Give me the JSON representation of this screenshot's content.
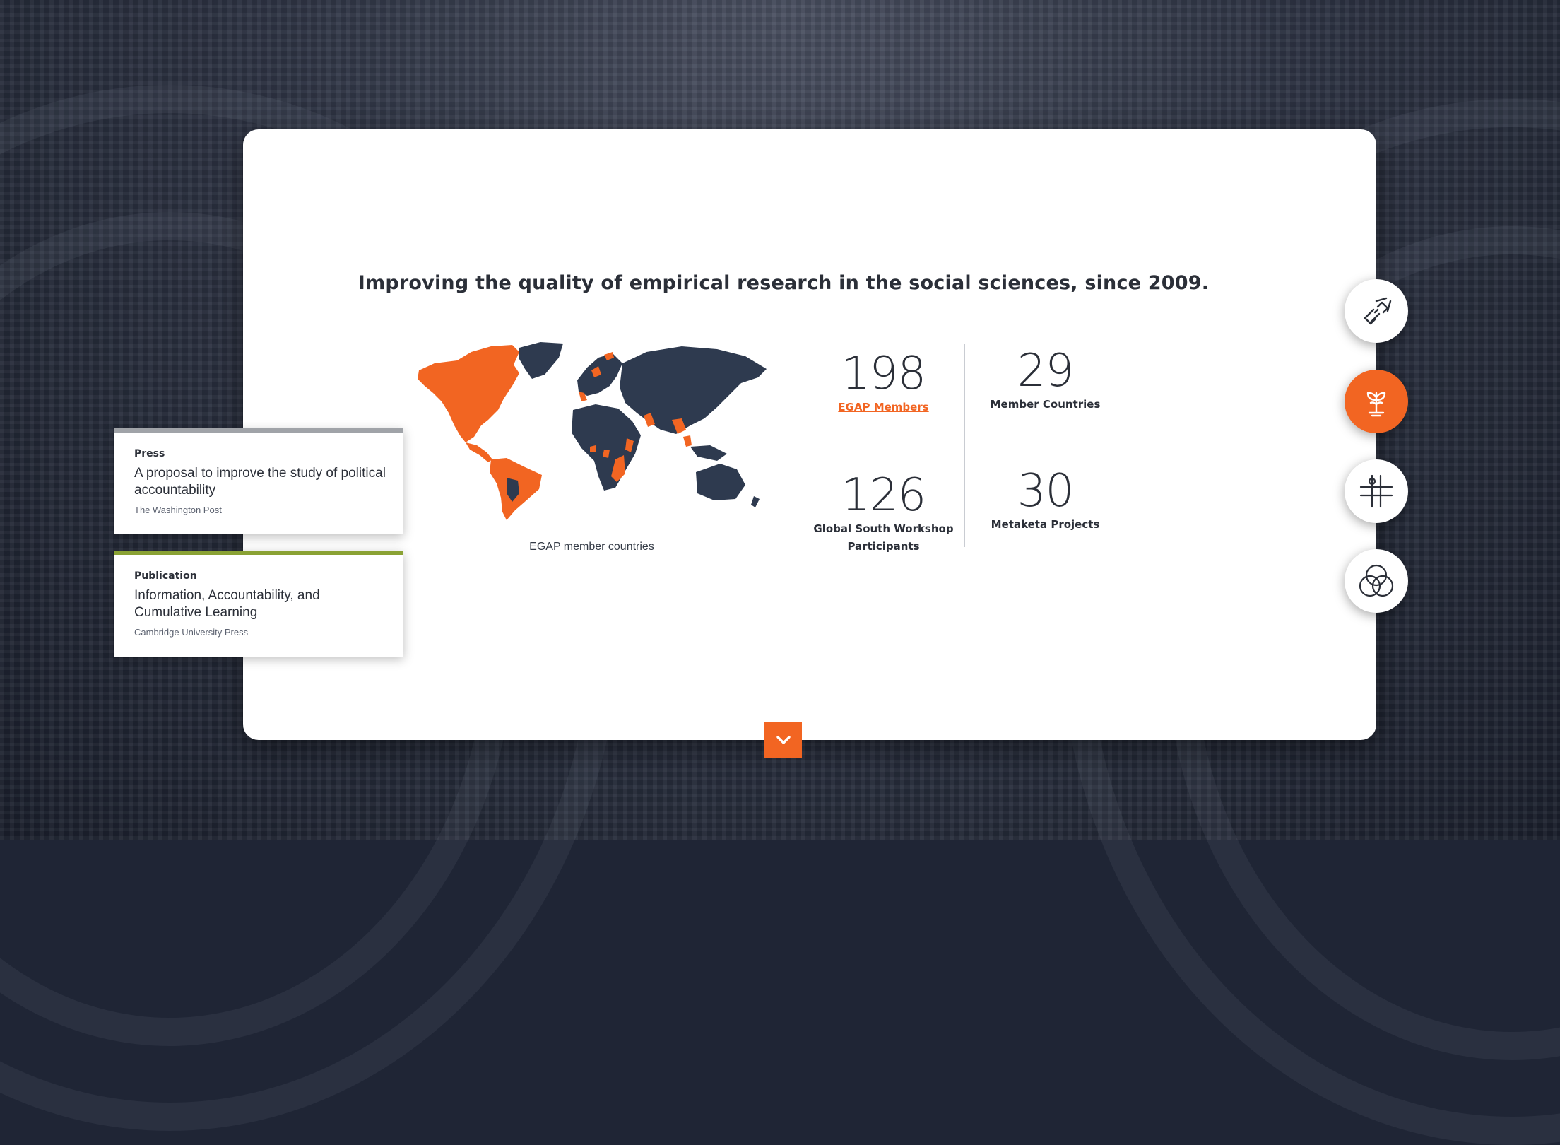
{
  "headline": "Improving the quality of empirical research in the social sciences, since 2009.",
  "map": {
    "caption": "EGAP member countries",
    "member_color": "#f26522",
    "other_color": "#2e3a4f"
  },
  "stats": [
    {
      "value": "198",
      "label": "EGAP Members",
      "is_link": true
    },
    {
      "value": "29",
      "label": "Member Countries",
      "is_link": false
    },
    {
      "value": "126",
      "label_line1": "Global South Workshop",
      "label_line2": "Participants",
      "is_link": false
    },
    {
      "value": "30",
      "label": "Metaketa Projects",
      "is_link": false
    }
  ],
  "news": [
    {
      "type": "Press",
      "title": "A proposal to improve the study of political accountability",
      "source": "The Washington Post",
      "bar_color": "#a0a3a8"
    },
    {
      "type": "Publication",
      "title": "Information, Accountability, and Cumulative Learning",
      "source": "Cambridge University Press",
      "bar_color": "#8aa234"
    }
  ],
  "side_nav": [
    {
      "icon": "link-chain-icon",
      "active": false
    },
    {
      "icon": "plant-growth-icon",
      "active": true
    },
    {
      "icon": "grid-crosshair-icon",
      "active": false
    },
    {
      "icon": "venn-circles-icon",
      "active": false
    }
  ],
  "scroll_down": {
    "icon": "chevron-down-icon"
  },
  "colors": {
    "accent": "#f26522",
    "text": "#2b2f38",
    "card": "#ffffff"
  }
}
